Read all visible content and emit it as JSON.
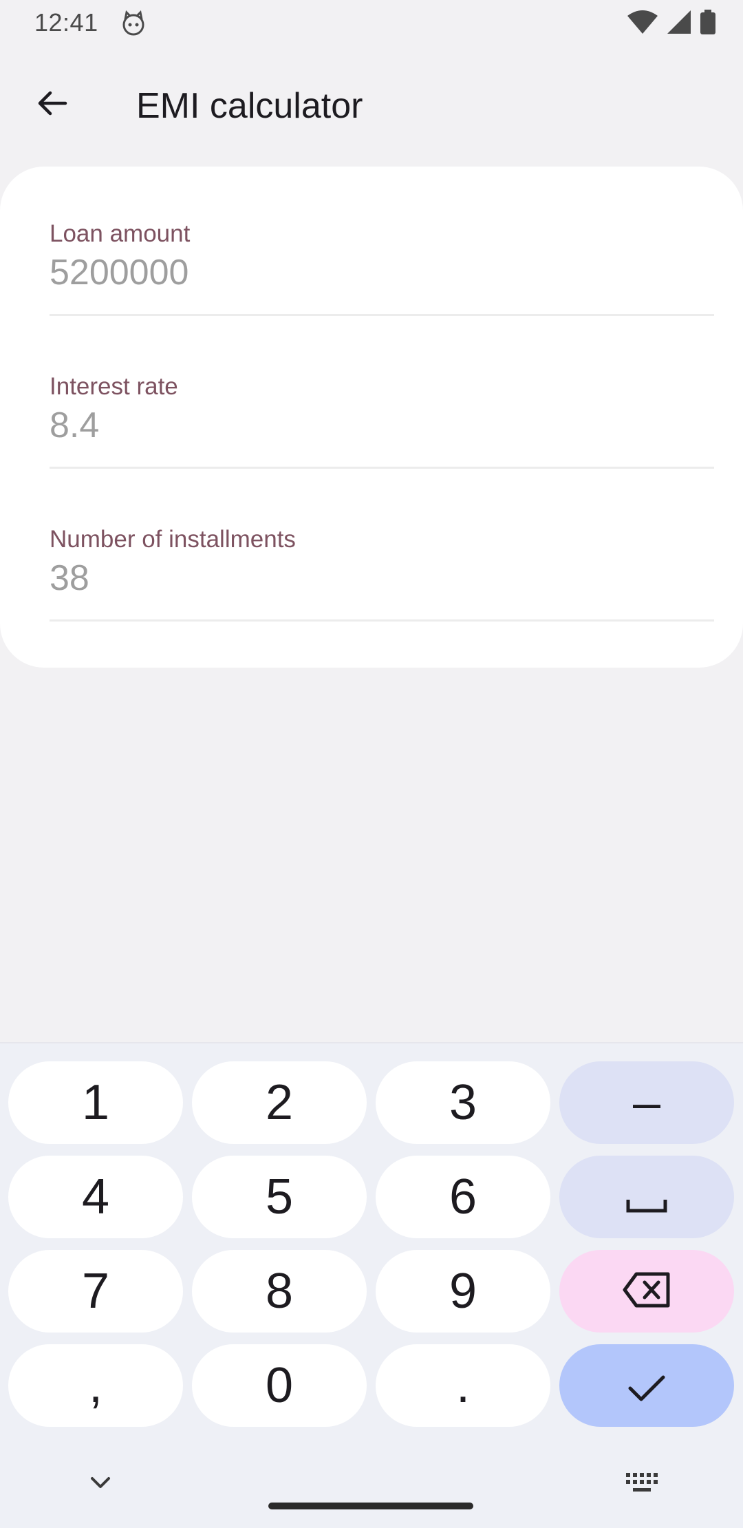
{
  "status": {
    "time": "12:41"
  },
  "app_bar": {
    "title": "EMI calculator"
  },
  "form": {
    "fields": [
      {
        "label": "Loan amount",
        "value": "5200000"
      },
      {
        "label": "Interest rate",
        "value": "8.4"
      },
      {
        "label": "Number of installments",
        "value": "38"
      }
    ]
  },
  "keyboard": {
    "keys": {
      "k1": "1",
      "k2": "2",
      "k3": "3",
      "minus": "–",
      "k4": "4",
      "k5": "5",
      "k6": "6",
      "space": "␣",
      "k7": "7",
      "k8": "8",
      "k9": "9",
      "comma": ",",
      "k0": "0",
      "period": "."
    }
  },
  "colors": {
    "background": "#f2f1f3",
    "label": "#7d5260",
    "value": "#9e9e9e",
    "key_function": "#dde1f5",
    "key_delete": "#fbd8f3",
    "key_done": "#b3c6fb"
  },
  "icons": {
    "back": "arrow-left-icon",
    "delete": "backspace-icon",
    "done": "check-icon",
    "hide_keyboard": "chevron-down-icon",
    "keyboard_switch": "keyboard-icon"
  }
}
